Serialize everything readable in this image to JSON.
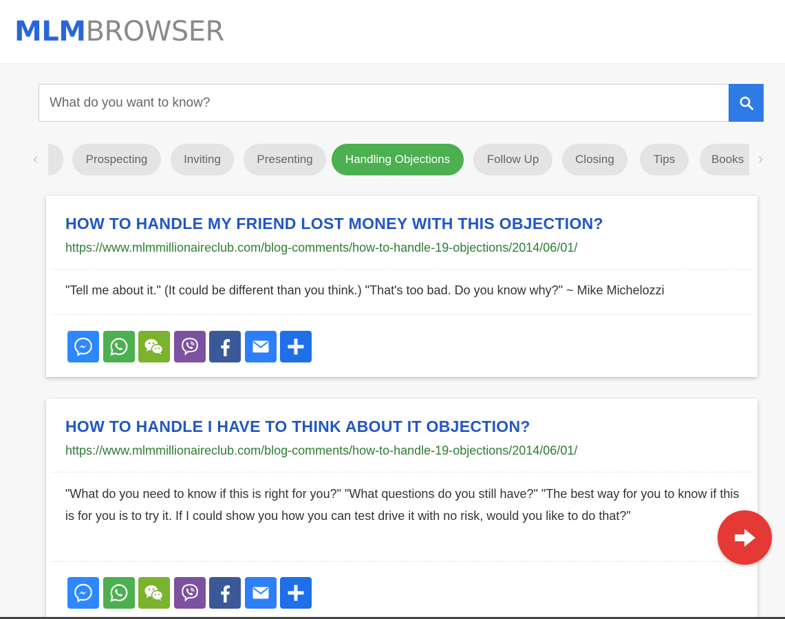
{
  "header": {
    "logo_part1": "MLM",
    "logo_part2": "BROWSER"
  },
  "search": {
    "placeholder": "What do you want to know?",
    "button_icon": "search-icon"
  },
  "categories": {
    "items": [
      "Prospecting",
      "Inviting",
      "Presenting",
      "Handling Objections",
      "Follow Up",
      "Closing",
      "Tips",
      "Books"
    ],
    "active": "Handling Objections",
    "prev_arrow": "‹",
    "next_arrow": "›"
  },
  "results": [
    {
      "title": "HOW TO HANDLE MY FRIEND LOST MONEY WITH THIS OBJECTION?",
      "url": "https://www.mlmmillionaireclub.com/blog-comments/how-to-handle-19-objections/2014/06/01/",
      "text": "\"Tell me about it.\" (It could be different than you think.) \"That's too bad. Do you know why?\" ~ Mike Michelozzi"
    },
    {
      "title": "HOW TO HANDLE I HAVE TO THINK ABOUT IT OBJECTION?",
      "url": "https://www.mlmmillionaireclub.com/blog-comments/how-to-handle-19-objections/2014/06/01/",
      "text": "\"What do you need to know if this is right for you?\" \"What questions do you still have?\" \"The best way for you to know if this is for you is to try it. If I could show you how you can test drive it with no risk, would you like to do that?\""
    }
  ],
  "share_buttons": [
    {
      "icon": "messenger-icon",
      "color": "#2d88ff"
    },
    {
      "icon": "whatsapp-icon",
      "color": "#4caf50"
    },
    {
      "icon": "wechat-icon",
      "color": "#7bb32e"
    },
    {
      "icon": "viber-icon",
      "color": "#7d519f"
    },
    {
      "icon": "facebook-icon",
      "color": "#3b5998"
    },
    {
      "icon": "email-icon",
      "color": "#2d7ff9"
    },
    {
      "icon": "more-share-icon",
      "color": "#1e6fe8"
    }
  ],
  "fab": {
    "icon": "arrow-right-icon",
    "color": "#e53935"
  },
  "colors": {
    "brand_blue": "#2b66d8",
    "active_chip": "#4caf50",
    "link_green": "#2e7d32"
  }
}
